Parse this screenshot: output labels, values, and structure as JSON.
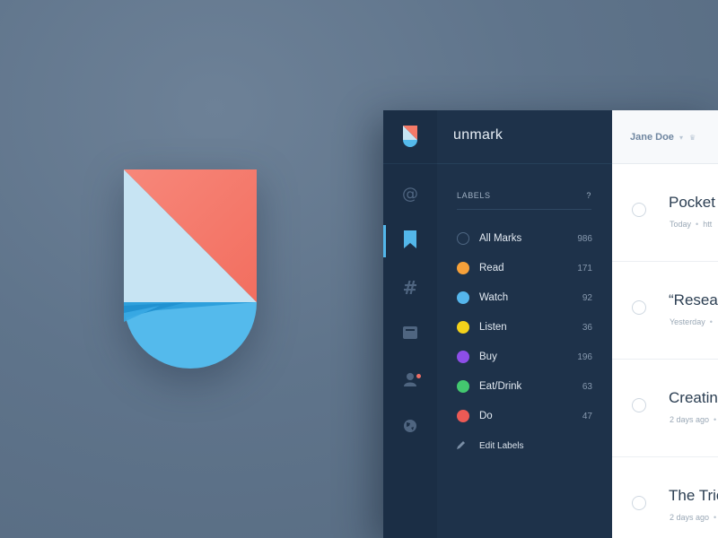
{
  "app": {
    "name": "unmark"
  },
  "labels_panel": {
    "header": "LABELS",
    "help": "?",
    "items": [
      {
        "label": "All Marks",
        "count": "986",
        "color": ""
      },
      {
        "label": "Read",
        "count": "171",
        "color": "#f6a13a"
      },
      {
        "label": "Watch",
        "count": "92",
        "color": "#55b6ec"
      },
      {
        "label": "Listen",
        "count": "36",
        "color": "#f4d21b"
      },
      {
        "label": "Buy",
        "count": "196",
        "color": "#8d4ee8"
      },
      {
        "label": "Eat/Drink",
        "count": "63",
        "color": "#43c86f"
      },
      {
        "label": "Do",
        "count": "47",
        "color": "#ec5a55"
      }
    ],
    "edit_labels": "Edit Labels"
  },
  "rail": {
    "icons": [
      "at-icon",
      "bookmark-icon",
      "hash-icon",
      "archive-icon",
      "user-icon",
      "globe-icon"
    ],
    "active": "bookmark-icon"
  },
  "marks_panel": {
    "user_name": "Jane Doe",
    "items": [
      {
        "title": "Pocket",
        "meta": "Today",
        "meta_more": "htt"
      },
      {
        "title": "“Resear",
        "meta": "Yesterday",
        "meta_more": ""
      },
      {
        "title": "Creating",
        "meta": "2 days ago",
        "meta_more": ""
      },
      {
        "title": "The Tric",
        "meta": "2 days ago",
        "meta_more": ""
      }
    ]
  },
  "colors": {
    "accent": "#53b7ea",
    "logo_coral": "#f57a68",
    "logo_light_blue": "#c6e3f3",
    "logo_blue": "#53b9ea",
    "sidebar_bg": "#1e324a"
  }
}
